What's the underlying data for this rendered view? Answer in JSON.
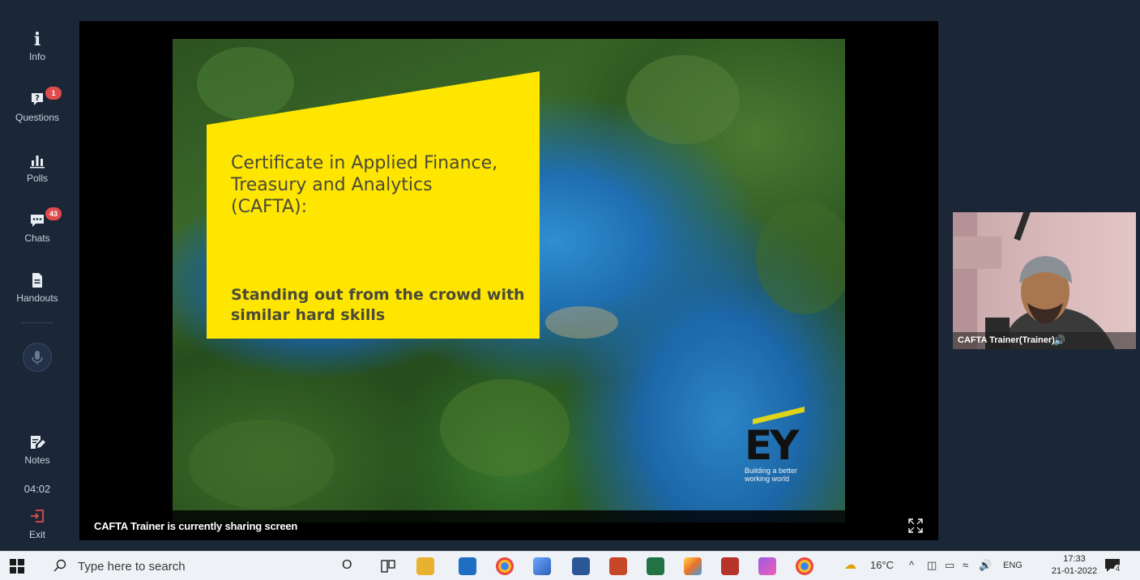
{
  "sidebar": {
    "items": [
      {
        "label": "Info",
        "icon": "info-icon",
        "glyph": "i"
      },
      {
        "label": "Questions",
        "icon": "question-icon",
        "glyph": "?",
        "badge": "1"
      },
      {
        "label": "Polls",
        "icon": "bar-chart-icon",
        "glyph": "▁▃▅"
      },
      {
        "label": "Chats",
        "icon": "chat-icon",
        "glyph": "…",
        "badge": "43"
      },
      {
        "label": "Handouts",
        "icon": "document-icon",
        "glyph": "≡"
      },
      {
        "label": "Notes",
        "icon": "notes-icon",
        "glyph": "✎"
      },
      {
        "label": "Exit",
        "icon": "exit-icon",
        "glyph": "↪"
      }
    ],
    "timer": "04:02"
  },
  "slide": {
    "title": "Certificate in Applied Finance,\nTreasury and Analytics\n(CAFTA):",
    "subtitle": "Standing out from the crowd with\nsimilar hard skills",
    "logo_text": "EY",
    "logo_tagline": "Building a better\nworking world",
    "panel_color": "#ffe600"
  },
  "stage": {
    "share_status": "CAFTA Trainer is currently sharing screen"
  },
  "video": {
    "name": "CAFTA Trainer(Trainer)"
  },
  "taskbar": {
    "search_placeholder": "Type here to search",
    "weather": "16°C",
    "language": "ENG",
    "time": "17:33",
    "date": "21-01-2022",
    "notification_count": "4"
  },
  "colors": {
    "sidebar_bg": "#1b2637",
    "badge": "#e04b4b",
    "accent_yellow": "#ffe600"
  }
}
